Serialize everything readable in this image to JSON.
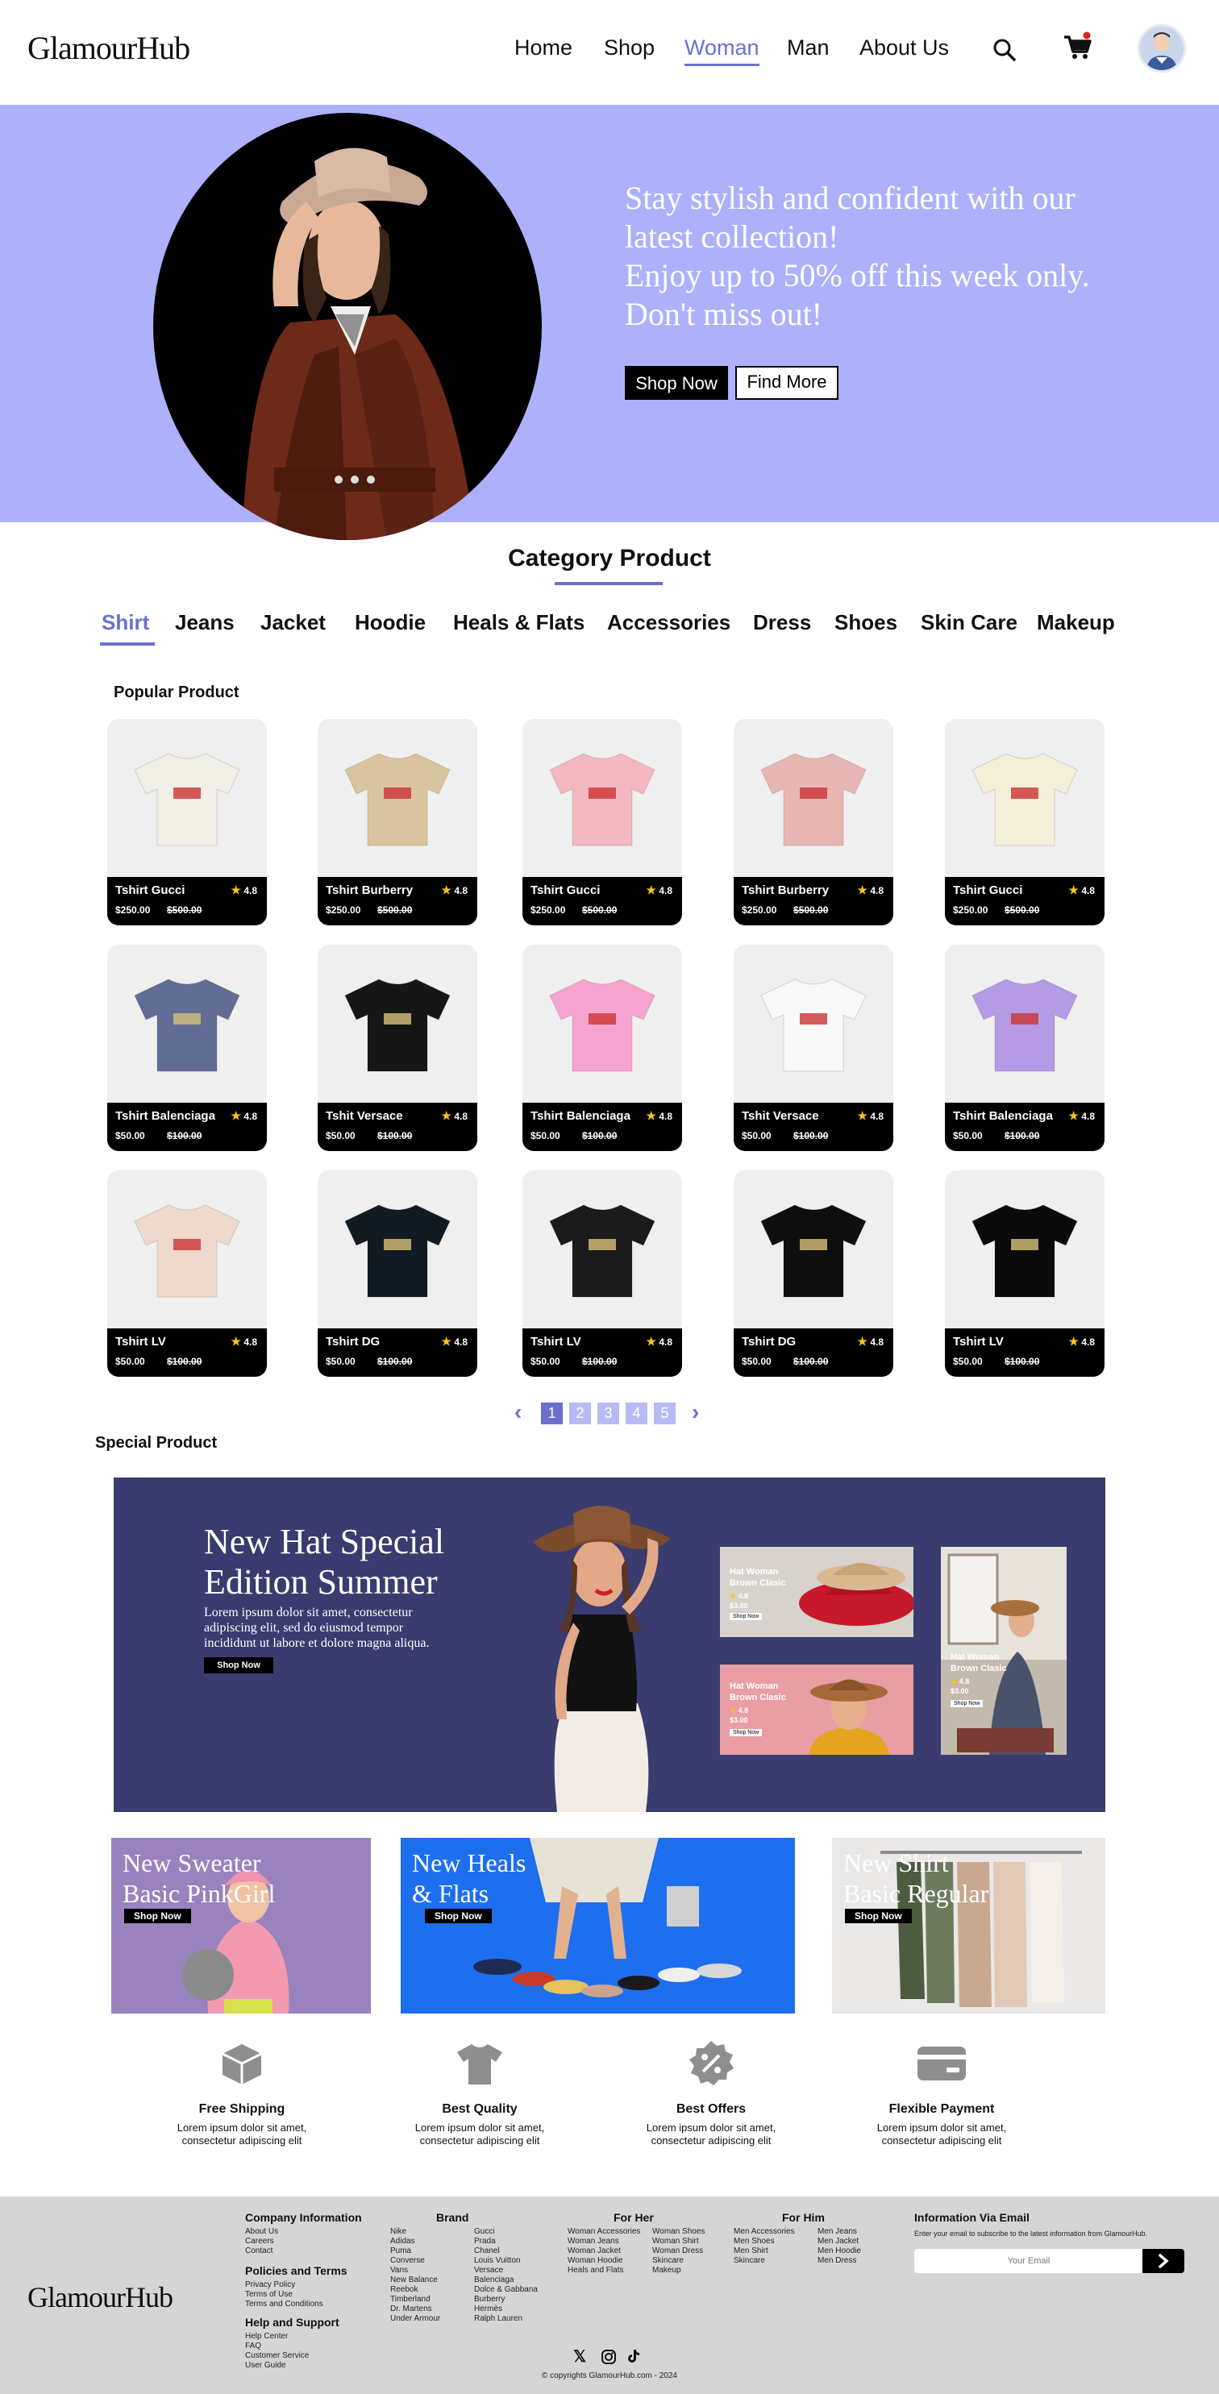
{
  "header": {
    "logo": "GlamourHub",
    "nav": [
      "Home",
      "Shop",
      "Woman",
      "Man",
      "About Us"
    ],
    "active_nav": "Woman",
    "icons": [
      "search-icon",
      "cart-icon",
      "avatar"
    ]
  },
  "hero": {
    "line1": "Stay stylish and confident with our",
    "line2": "latest collection!",
    "line3": "Enjoy up to 50% off this week only.",
    "line4": "Don't miss out!",
    "shop_now": "Shop Now",
    "find_more": "Find More"
  },
  "category": {
    "title": "Category Product",
    "tabs": [
      "Shirt",
      "Jeans",
      "Jacket",
      "Hoodie",
      "Heals & Flats",
      "Accessories",
      "Dress",
      "Shoes",
      "Skin Care",
      "Makeup"
    ],
    "active_tab": "Shirt"
  },
  "popular": {
    "label": "Popular Product",
    "products": [
      {
        "name": "Tshirt Gucci",
        "rating": "4.8",
        "price": "$250.00",
        "old_price": "$500.00"
      },
      {
        "name": "Tshirt Burberry",
        "rating": "4.8",
        "price": "$250.00",
        "old_price": "$500.00"
      },
      {
        "name": "Tshirt Gucci",
        "rating": "4.8",
        "price": "$250.00",
        "old_price": "$500.00"
      },
      {
        "name": "Tshirt  Burberry",
        "rating": "4.8",
        "price": "$250.00",
        "old_price": "$500.00"
      },
      {
        "name": "Tshirt Gucci",
        "rating": "4.8",
        "price": "$250.00",
        "old_price": "$500.00"
      },
      {
        "name": "Tshirt Balenciaga",
        "rating": "4.8",
        "price": "$50.00",
        "old_price": "$100.00"
      },
      {
        "name": "Tshit Versace",
        "rating": "4.8",
        "price": "$50.00",
        "old_price": "$100.00"
      },
      {
        "name": "Tshirt Balenciaga",
        "rating": "4.8",
        "price": "$50.00",
        "old_price": "$100.00"
      },
      {
        "name": "Tshit Versace",
        "rating": "4.8",
        "price": "$50.00",
        "old_price": "$100.00"
      },
      {
        "name": "Tshirt Balenciaga",
        "rating": "4.8",
        "price": "$50.00",
        "old_price": "$100.00"
      },
      {
        "name": "Tshirt LV",
        "rating": "4.8",
        "price": "$50.00",
        "old_price": "$100.00"
      },
      {
        "name": "Tshirt DG",
        "rating": "4.8",
        "price": "$50.00",
        "old_price": "$100.00"
      },
      {
        "name": "Tshirt LV",
        "rating": "4.8",
        "price": "$50.00",
        "old_price": "$100.00"
      },
      {
        "name": "Tshirt DG",
        "rating": "4.8",
        "price": "$50.00",
        "old_price": "$100.00"
      },
      {
        "name": "Tshirt LV",
        "rating": "4.8",
        "price": "$50.00",
        "old_price": "$100.00"
      }
    ],
    "shirt_colors": [
      "#f1efe6",
      "#d9c4a0",
      "#f5b8c0",
      "#e8b6b2",
      "#f3efd9",
      "#626d96",
      "#161616",
      "#f7a3d0",
      "#f8f8f8",
      "#b59ae6",
      "#efd8cc",
      "#121a22",
      "#1b1b1b",
      "#0e0e0e",
      "#0a0a0a"
    ]
  },
  "pagination": {
    "pages": [
      "1",
      "2",
      "3",
      "4",
      "5"
    ],
    "current": "1"
  },
  "special": {
    "label": "Special Product",
    "title_line1": "New Hat Special",
    "title_line2": "Edition Summer",
    "desc_line1": "Lorem ipsum dolor sit amet, consectetur",
    "desc_line2": "adipiscing elit, sed do eiusmod tempor",
    "desc_line3": "incididunt ut labore et dolore magna aliqua.",
    "button": "Shop Now",
    "mini": [
      {
        "title1": "Hat Woman",
        "title2": "Brown Clasic",
        "rating": "4.8",
        "price": "$3.00",
        "button": "Shop Now"
      },
      {
        "title1": "Hat Woman",
        "title2": "Brown Clasic",
        "rating": "4.8",
        "price": "$3.00",
        "button": "Shop Now"
      },
      {
        "title1": "Hat Woman",
        "title2": "Brown Clasic",
        "rating": "4.8",
        "price": "$3.00",
        "button": "Shop Now"
      }
    ]
  },
  "banners": [
    {
      "line1": "New Sweater",
      "line2": "Basic PinkGirl",
      "button": "Shop Now"
    },
    {
      "line1": "New Heals",
      "line2": "& Flats",
      "button": "Shop Now"
    },
    {
      "line1": "New Shirt",
      "line2": "Basic Regular",
      "button": "Shop Now"
    }
  ],
  "features": [
    {
      "title": "Free Shipping",
      "desc1": "Lorem ipsum dolor sit amet,",
      "desc2": "consectetur adipiscing elit"
    },
    {
      "title": "Best Quality",
      "desc1": "Lorem ipsum dolor sit amet,",
      "desc2": "consectetur adipiscing elit"
    },
    {
      "title": "Best Offers",
      "desc1": "Lorem ipsum dolor sit amet,",
      "desc2": "consectetur adipiscing elit"
    },
    {
      "title": "Flexible Payment",
      "desc1": "Lorem ipsum dolor sit amet,",
      "desc2": "consectetur adipiscing elit"
    }
  ],
  "footer": {
    "logo": "GlamourHub",
    "company": {
      "title": "Company Information",
      "links": [
        "About Us",
        "Careers",
        "Contact"
      ]
    },
    "policies": {
      "title": "Policies and Terms",
      "links": [
        "Privacy Policy",
        "Terms of Use",
        "Terms and Conditions"
      ]
    },
    "help": {
      "title": "Help and Support",
      "links": [
        "Help Center",
        "FAQ",
        "Customer Service",
        "User Guide"
      ]
    },
    "brand": {
      "title": "Brand",
      "col1": [
        "Nike",
        "Adidas",
        "Puma",
        "Converse",
        "Vans",
        "New Balance",
        "Reebok",
        "Timberland",
        "Dr. Martens",
        "Under Armour"
      ],
      "col2": [
        "Gucci",
        "Prada",
        "Chanel",
        "Louis Vuitton",
        "Versace",
        "Balenciaga",
        "Dolce & Gabbana",
        "Burberry",
        "Hermès",
        "Ralph Lauren"
      ]
    },
    "for_her": {
      "title": "For Her",
      "col1": [
        "Woman Accessories",
        "Woman Jeans",
        "Woman Jacket",
        "Woman Hoodie",
        "Heals and Flats"
      ],
      "col2": [
        "Woman Shoes",
        "Woman Shirt",
        "Woman Dress",
        "Skincare",
        "Makeup"
      ]
    },
    "for_him": {
      "title": "For Him",
      "col1": [
        "Men Accessories",
        "Men Shoes",
        "Men Shirt",
        "Skincare"
      ],
      "col2": [
        "Men Jeans",
        "Men Jacket",
        "Men Hoodie",
        "Men Dress"
      ]
    },
    "newsletter": {
      "title": "Information Via Email",
      "desc": "Enter your email to subscribe to the latest information from GlamourHub.",
      "placeholder": "Your Email"
    },
    "social": [
      "x-icon",
      "instagram-icon",
      "tiktok-icon"
    ],
    "copyright": "© copyrights GlamourHub.com - 2024"
  },
  "colors": {
    "accent": "#6a6fd0",
    "hero_bg": "#adb1fb",
    "special_bg": "#3a3b6e",
    "footer_bg": "#d5d5d5",
    "star": "#f5c518"
  }
}
